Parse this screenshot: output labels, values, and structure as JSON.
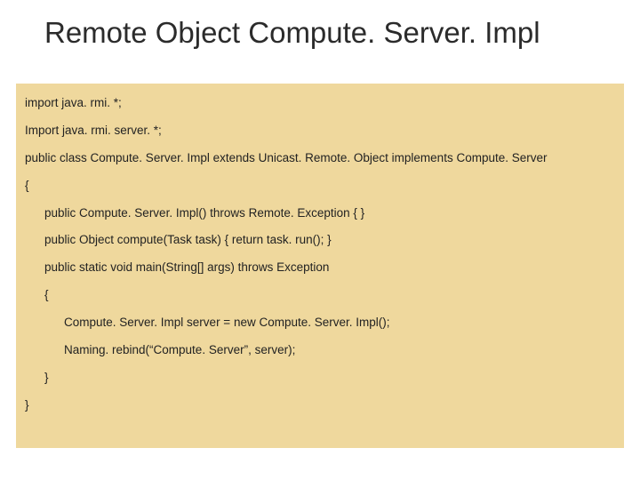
{
  "title": "Remote Object Compute. Server. Impl",
  "code": {
    "l1": "import java. rmi. *;",
    "l2": "Import java. rmi. server. *;",
    "l3": "public class Compute. Server. Impl extends Unicast. Remote. Object implements Compute. Server",
    "l4": "{",
    "l5": "public Compute. Server. Impl() throws Remote. Exception { }",
    "l6": "public Object compute(Task task) { return task. run(); }",
    "l7": "public static void main(String[] args) throws Exception",
    "l8": "{",
    "l9": "Compute. Server. Impl server = new Compute. Server. Impl();",
    "l10": "Naming. rebind(“Compute. Server”, server);",
    "l11": "}",
    "l12": "}"
  }
}
